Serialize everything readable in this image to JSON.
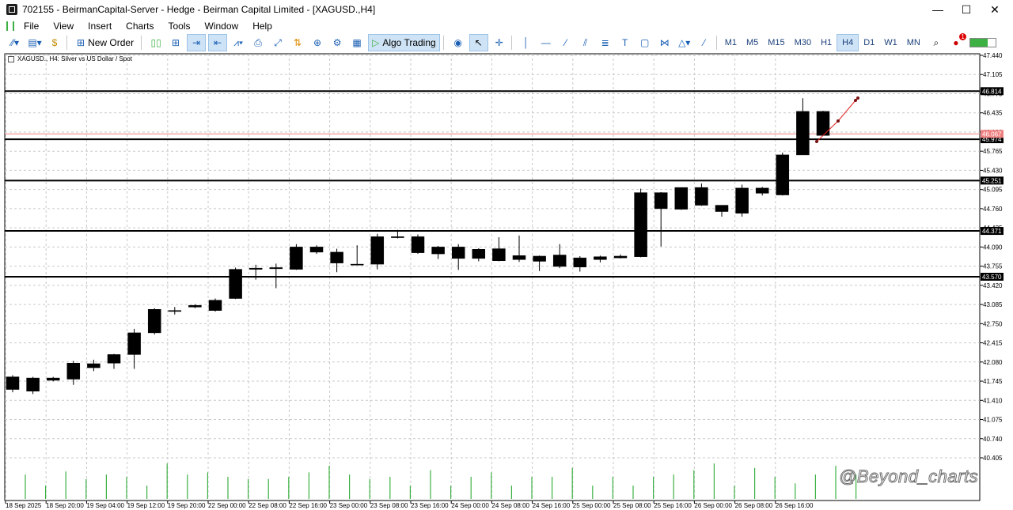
{
  "window": {
    "title": "702155 - BeirmanCapital-Server - Hedge - Beirman Capital Limited - [XAGUSD.,H4]",
    "minimize": "—",
    "maximize": "☐",
    "close": "✕"
  },
  "menu": [
    "File",
    "View",
    "Insert",
    "Charts",
    "Tools",
    "Window",
    "Help"
  ],
  "toolbar": {
    "new_order": "New Order",
    "algo_trading": "Algo Trading",
    "timeframes": [
      "M1",
      "M5",
      "M15",
      "M30",
      "H1",
      "H4",
      "D1",
      "W1",
      "MN"
    ],
    "active_timeframe": "H4",
    "notification_count": "1"
  },
  "chart": {
    "header": "XAGUSD., H4:  Silver vs US Dollar / Spot",
    "watermark": "@Beyond_charts",
    "y_ticks": [
      "47.440",
      "47.105",
      "46.770",
      "46.435",
      "46.100",
      "45.765",
      "45.430",
      "45.095",
      "44.760",
      "44.425",
      "44.090",
      "43.755",
      "43.420",
      "43.085",
      "42.750",
      "42.415",
      "42.080",
      "41.745",
      "41.410",
      "41.075",
      "40.740",
      "40.405"
    ],
    "x_ticks": [
      "18 Sep 2025",
      "18 Sep 20:00",
      "19 Sep 04:00",
      "19 Sep 12:00",
      "19 Sep 20:00",
      "22 Sep 00:00",
      "22 Sep 08:00",
      "22 Sep 16:00",
      "23 Sep 00:00",
      "23 Sep 08:00",
      "23 Sep 16:00",
      "24 Sep 00:00",
      "24 Sep 08:00",
      "24 Sep 16:00",
      "25 Sep 00:00",
      "25 Sep 08:00",
      "25 Sep 16:00",
      "26 Sep 00:00",
      "26 Sep 08:00",
      "26 Sep 16:00"
    ],
    "levels": [
      {
        "price": 46.814,
        "label": "46.814"
      },
      {
        "price": 45.974,
        "label": "45.974"
      },
      {
        "price": 45.251,
        "label": "45.251"
      },
      {
        "price": 44.371,
        "label": "44.371"
      },
      {
        "price": 43.57,
        "label": "43.570"
      }
    ],
    "bid_line": {
      "price": 46.067,
      "label": "46.067"
    },
    "colors": {
      "candle": "#000000",
      "volume": "#3cb043",
      "level_line": "#000000",
      "bid_line": "#f08080",
      "projection": "#e02020",
      "tag_bg": "#000000",
      "tag_text": "#ffffff",
      "grid": "#c9c9c9"
    }
  },
  "chart_data": {
    "type": "candlestick",
    "symbol": "XAGUSD.",
    "timeframe": "H4",
    "ylim": [
      40.405,
      47.44
    ],
    "candles": [
      {
        "o": 41.6,
        "h": 41.85,
        "l": 41.55,
        "c": 41.82
      },
      {
        "o": 41.57,
        "h": 41.82,
        "l": 41.52,
        "c": 41.8
      },
      {
        "o": 41.76,
        "h": 41.82,
        "l": 41.74,
        "c": 41.8
      },
      {
        "o": 41.78,
        "h": 42.1,
        "l": 41.68,
        "c": 42.06
      },
      {
        "o": 41.98,
        "h": 42.12,
        "l": 41.92,
        "c": 42.05
      },
      {
        "o": 42.06,
        "h": 42.22,
        "l": 41.96,
        "c": 42.21
      },
      {
        "o": 42.21,
        "h": 42.66,
        "l": 41.96,
        "c": 42.59
      },
      {
        "o": 42.59,
        "h": 43.02,
        "l": 42.56,
        "c": 43.0
      },
      {
        "o": 42.97,
        "h": 43.04,
        "l": 42.91,
        "c": 42.98
      },
      {
        "o": 43.04,
        "h": 43.09,
        "l": 43.02,
        "c": 43.07
      },
      {
        "o": 42.98,
        "h": 43.19,
        "l": 42.96,
        "c": 43.16
      },
      {
        "o": 43.19,
        "h": 43.73,
        "l": 43.18,
        "c": 43.7
      },
      {
        "o": 43.7,
        "h": 43.78,
        "l": 43.52,
        "c": 43.72
      },
      {
        "o": 43.71,
        "h": 43.8,
        "l": 43.37,
        "c": 43.73
      },
      {
        "o": 43.7,
        "h": 44.14,
        "l": 43.69,
        "c": 44.09
      },
      {
        "o": 44.09,
        "h": 44.12,
        "l": 43.97,
        "c": 44.0
      },
      {
        "o": 44.0,
        "h": 44.06,
        "l": 43.65,
        "c": 43.81
      },
      {
        "o": 43.79,
        "h": 44.12,
        "l": 43.77,
        "c": 43.79
      },
      {
        "o": 43.79,
        "h": 44.32,
        "l": 43.7,
        "c": 44.27
      },
      {
        "o": 44.26,
        "h": 44.39,
        "l": 44.24,
        "c": 44.27
      },
      {
        "o": 44.27,
        "h": 44.31,
        "l": 43.97,
        "c": 43.99
      },
      {
        "o": 44.09,
        "h": 44.11,
        "l": 43.88,
        "c": 43.97
      },
      {
        "o": 44.09,
        "h": 44.14,
        "l": 43.69,
        "c": 43.89
      },
      {
        "o": 44.05,
        "h": 44.07,
        "l": 43.84,
        "c": 43.89
      },
      {
        "o": 43.85,
        "h": 44.26,
        "l": 43.84,
        "c": 44.06
      },
      {
        "o": 43.94,
        "h": 44.29,
        "l": 43.83,
        "c": 43.87
      },
      {
        "o": 43.93,
        "h": 43.94,
        "l": 43.67,
        "c": 43.84
      },
      {
        "o": 43.95,
        "h": 44.14,
        "l": 43.72,
        "c": 43.75
      },
      {
        "o": 43.9,
        "h": 43.93,
        "l": 43.66,
        "c": 43.74
      },
      {
        "o": 43.87,
        "h": 43.94,
        "l": 43.82,
        "c": 43.92
      },
      {
        "o": 43.9,
        "h": 43.96,
        "l": 43.89,
        "c": 43.93
      },
      {
        "o": 43.92,
        "h": 45.11,
        "l": 43.91,
        "c": 45.04
      },
      {
        "o": 45.04,
        "h": 45.05,
        "l": 44.1,
        "c": 44.76
      },
      {
        "o": 44.75,
        "h": 45.13,
        "l": 44.74,
        "c": 45.13
      },
      {
        "o": 44.82,
        "h": 45.2,
        "l": 44.81,
        "c": 45.13
      },
      {
        "o": 44.82,
        "h": 44.82,
        "l": 44.62,
        "c": 44.71
      },
      {
        "o": 44.68,
        "h": 45.18,
        "l": 44.62,
        "c": 45.12
      },
      {
        "o": 45.03,
        "h": 45.14,
        "l": 44.99,
        "c": 45.12
      },
      {
        "o": 45.0,
        "h": 45.74,
        "l": 44.99,
        "c": 45.7
      },
      {
        "o": 45.7,
        "h": 46.69,
        "l": 45.7,
        "c": 46.46
      },
      {
        "o": 46.46,
        "h": 46.47,
        "l": 46.03,
        "c": 46.04
      }
    ],
    "volumes": [
      0.55,
      0.3,
      0.62,
      0.45,
      0.55,
      0.5,
      0.3,
      0.8,
      0.55,
      0.6,
      0.5,
      0.45,
      0.45,
      0.5,
      0.6,
      0.75,
      0.55,
      0.45,
      0.5,
      0.3,
      0.65,
      0.3,
      0.5,
      0.6,
      0.3,
      0.5,
      0.5,
      0.7,
      0.3,
      0.5,
      0.3,
      0.5,
      0.55,
      0.65,
      0.8,
      0.3,
      0.7,
      0.5,
      0.35,
      0.55,
      0.75,
      0.55
    ]
  }
}
